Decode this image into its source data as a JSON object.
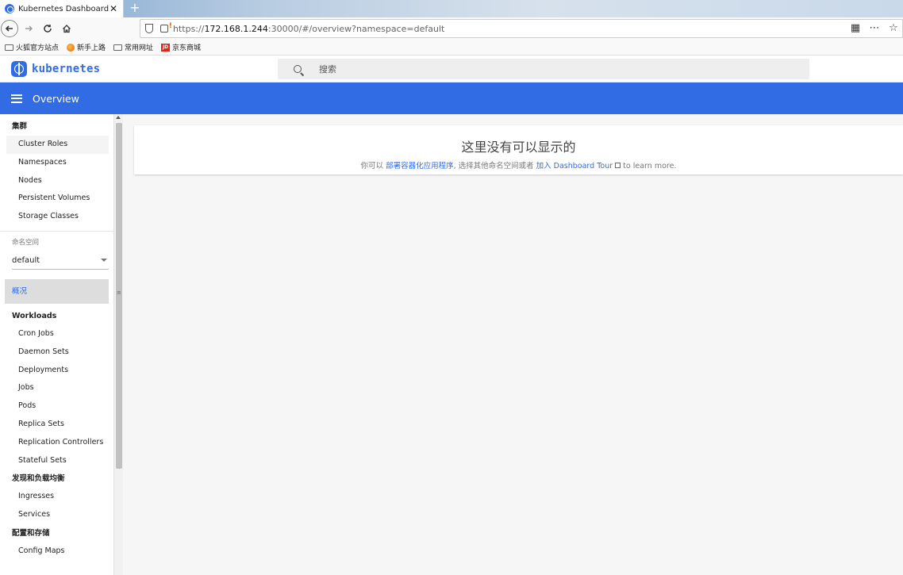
{
  "browser": {
    "tab_title": "Kubernetes Dashboard",
    "tab_close": "✕",
    "new_tab": "+",
    "url_prefix": "https://",
    "url_host": "172.168.1.244",
    "url_rest": ":30000/#/overview?namespace=default",
    "bookmarks": [
      "火狐官方站点",
      "新手上路",
      "常用网址",
      "京东商城"
    ],
    "jd_logo": "JD"
  },
  "app": {
    "brand": "kubernetes",
    "search_placeholder": "搜索",
    "toolbar_title": "Overview"
  },
  "sidebar": {
    "cluster_header": "集群",
    "cluster_items": [
      "Cluster Roles",
      "Namespaces",
      "Nodes",
      "Persistent Volumes",
      "Storage Classes"
    ],
    "namespace_label": "命名空间",
    "namespace_value": "default",
    "overview_label": "概况",
    "workloads_header": "Workloads",
    "workloads_items": [
      "Cron Jobs",
      "Daemon Sets",
      "Deployments",
      "Jobs",
      "Pods",
      "Replica Sets",
      "Replication Controllers",
      "Stateful Sets"
    ],
    "discovery_header": "发现和负载均衡",
    "discovery_items": [
      "Ingresses",
      "Services"
    ],
    "config_header": "配置和存储",
    "config_items": [
      "Config Maps"
    ]
  },
  "main": {
    "empty_heading": "这里没有可以显示的",
    "sub_prefix": "你可以 ",
    "deploy_link": "部署容器化应用程序",
    "sub_middle": ", 选择其他命名空间或者 ",
    "tour_link": "加入 Dashboard Tour",
    "sub_suffix": " to learn more."
  },
  "colors": {
    "brand": "#326ce5",
    "toolbar": "#326ce5"
  }
}
